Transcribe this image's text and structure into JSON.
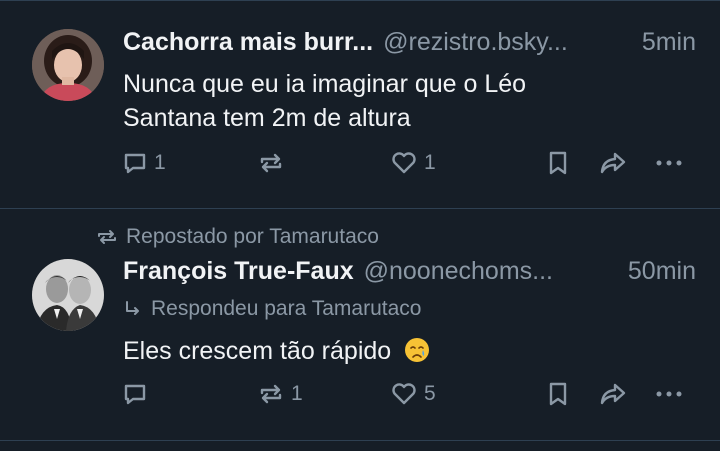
{
  "posts": [
    {
      "author": "Cachorra mais burr...",
      "handle": "@rezistro.bsky...",
      "time": "5min",
      "text_lines": [
        "Nunca que eu ia imaginar que o Léo",
        "Santana tem 2m de altura"
      ],
      "reply_count": "1",
      "repost_count": "",
      "like_count": "1"
    },
    {
      "repost_label": "Repostado por Tamarutaco",
      "author": "François True-Faux",
      "handle": "@noonechoms...",
      "time": "50min",
      "reply_to_label": "Respondeu para Tamarutaco",
      "text": "Eles crescem tão rápido",
      "reply_count": "",
      "repost_count": "1",
      "like_count": "5"
    }
  ],
  "colors": {
    "background": "#161e27",
    "divider": "#2e4052",
    "muted": "#8b98a5",
    "text": "#f1f3f5"
  },
  "icons": {
    "reply": "speech-bubble-icon",
    "repost": "repost-arrows-icon",
    "like": "heart-outline-icon",
    "bookmark": "bookmark-icon",
    "share": "share-arrow-icon",
    "more": "more-dots-icon",
    "emoji": "crying-face-emoji"
  }
}
